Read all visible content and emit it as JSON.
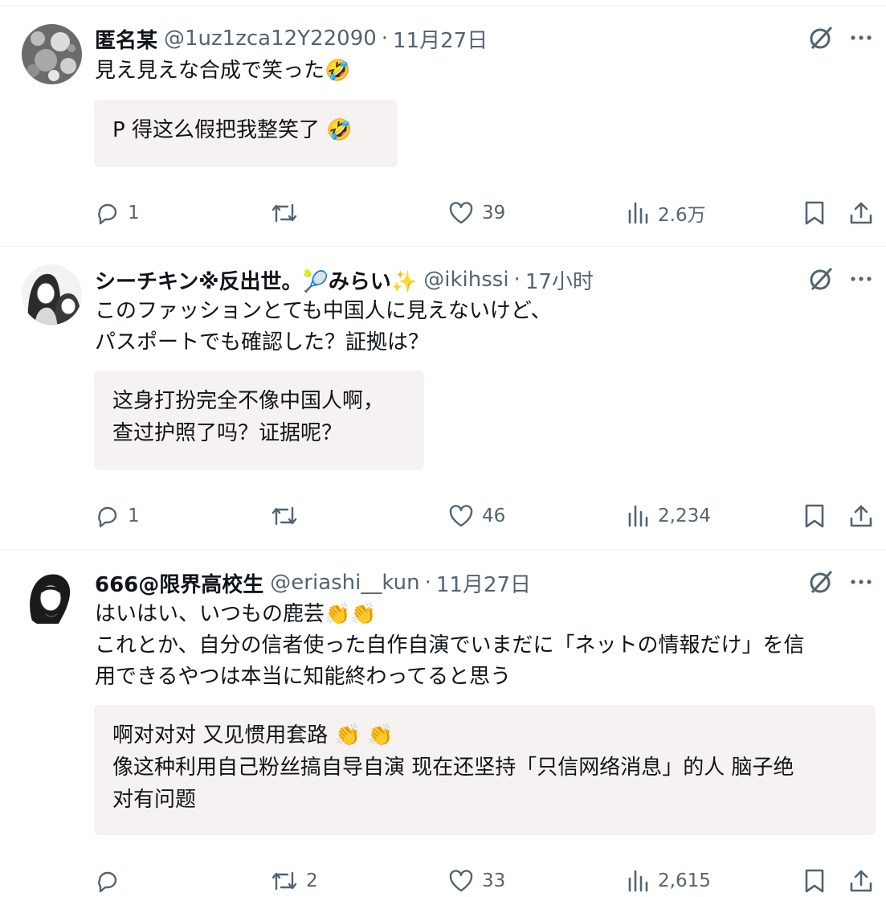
{
  "posts": [
    {
      "name": "匿名某",
      "name_emoji": "",
      "handle": "@1uz1zca12Y22090",
      "time": "11月27日",
      "text_lines": [
        "見え見えな合成で笑った🤣"
      ],
      "translation_lines": [
        "P 得这么假把我整笑了 🤣"
      ],
      "stats": {
        "replies": "1",
        "reposts": "",
        "likes": "39",
        "views": "2.6万"
      }
    },
    {
      "name": "シーチキン※反出世。🎾みらい✨",
      "name_emoji": "",
      "handle": "@ikihssi",
      "time": "17小时",
      "text_lines": [
        "このファッションとても中国人に見えないけど、",
        "パスポートでも確認した？証拠は？"
      ],
      "translation_lines": [
        "这身打扮完全不像中国人啊，",
        "查过护照了吗？证据呢？"
      ],
      "stats": {
        "replies": "1",
        "reposts": "",
        "likes": "46",
        "views": "2,234"
      }
    },
    {
      "name": "666@限界高校生",
      "name_emoji": "",
      "handle": "@eriashi__kun",
      "time": "11月27日",
      "text_lines": [
        "はいはい、いつもの鹿芸👏👏",
        "これとか、自分の信者使った自作自演でいまだに「ネットの情報だけ」を信",
        "用できるやつは本当に知能終わってると思う"
      ],
      "translation_lines": [
        "啊对对对 又见惯用套路 👏  👏",
        "像这种利用自己粉丝搞自导自演 现在还坚持「只信网络消息」的人 脑子绝",
        "对有问题"
      ],
      "stats": {
        "replies": "",
        "reposts": "2",
        "likes": "33",
        "views": "2,615"
      }
    }
  ],
  "icons": {
    "reply": "reply-icon",
    "repost": "repost-icon",
    "like": "heart-icon",
    "views": "views-icon",
    "bookmark": "bookmark-icon",
    "share": "share-icon",
    "grok": "grok-icon",
    "more": "more-icon"
  },
  "colors": {
    "text": "#0f1419",
    "secondary": "#536471",
    "translation_bg": "#f7f2f2",
    "divider": "#eff3f4"
  }
}
